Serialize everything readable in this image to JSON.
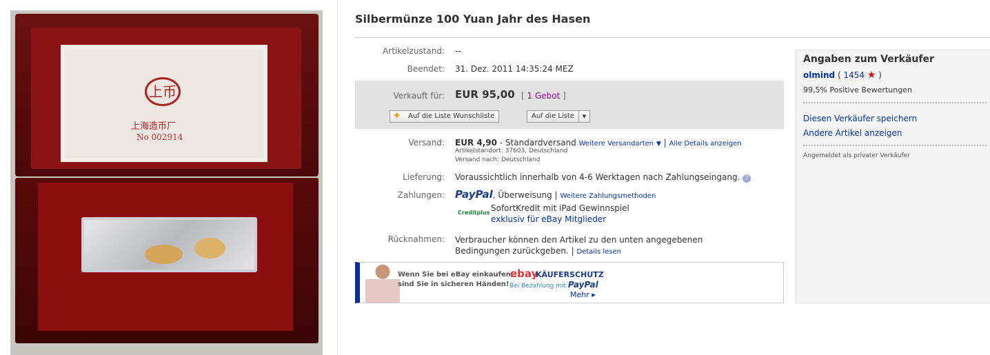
{
  "item": {
    "title": "Silbermünze 100 Yuan Jahr des Hasen",
    "photo": {
      "card_text": "上海造币厂",
      "card_logo": "上币",
      "card_number": "No 002914"
    }
  },
  "details": {
    "condition_label": "Artikelzustand:",
    "condition_value": "--",
    "ended_label": "Beendet:",
    "ended_value": "31. Dez. 2011 14:35:24 MEZ",
    "sold_label": "Verkauft für:",
    "sold_price": "EUR 95,00",
    "bids_open": "[",
    "bids_link": "1 Gebot",
    "bids_close": "]",
    "wishlist_button": "Auf die Liste Wunschliste",
    "list_button": "Auf die Liste",
    "shipping_label": "Versand:",
    "shipping_price": "EUR 4,90",
    "shipping_type": "- Standardversand",
    "more_shipping": "Weitere Versandarten",
    "sep": "|",
    "all_details": "Alle Details anzeigen",
    "location": "Artikelstandort: 37603, Deutschland",
    "ships_to": "Versand nach: Deutschland",
    "delivery_label": "Lieferung:",
    "delivery_value": "Voraussichtlich innerhalb von 4-6 Werktagen nach Zahlungseingang.",
    "payment_label": "Zahlungen:",
    "paypal": "PayPal",
    "payment_other": ", Überweisung |",
    "more_payment": "Weitere Zahlungsmethoden",
    "creditplus": "Creditplus",
    "credit_text": "SofortKredit mit iPad Gewinnspiel",
    "credit_link": "exklusiv für eBay Mitglieder",
    "returns_label": "Rücknahmen:",
    "returns_value": "Verbraucher können den Artikel zu den unten angegebenen Bedingungen zurückgeben. |",
    "returns_link": "Details lesen"
  },
  "banner": {
    "line1": "Wenn Sie bei eBay einkaufen,",
    "line2": "sind Sie in sicheren Händen!",
    "ebay": "ebay",
    "protection": "KÄUFERSCHUTZ",
    "pay_with": "Bei Bezahlung mit",
    "paypal": "PayPal",
    "more": "Mehr ▸"
  },
  "seller": {
    "heading": "Angaben zum Verkäufer",
    "name": "olmind",
    "open": "(",
    "score": "1454",
    "close": ")",
    "positive": "99,5% Positive Bewertungen",
    "save": "Diesen Verkäufer speichern",
    "other_items": "Andere Artikel anzeigen",
    "type": "Angemeldet als privater Verkäufer",
    "star_color": "#e00000"
  },
  "colors": {
    "link": "#0033aa",
    "bids": "#990099",
    "banner_bar": "#0b2f9a"
  }
}
